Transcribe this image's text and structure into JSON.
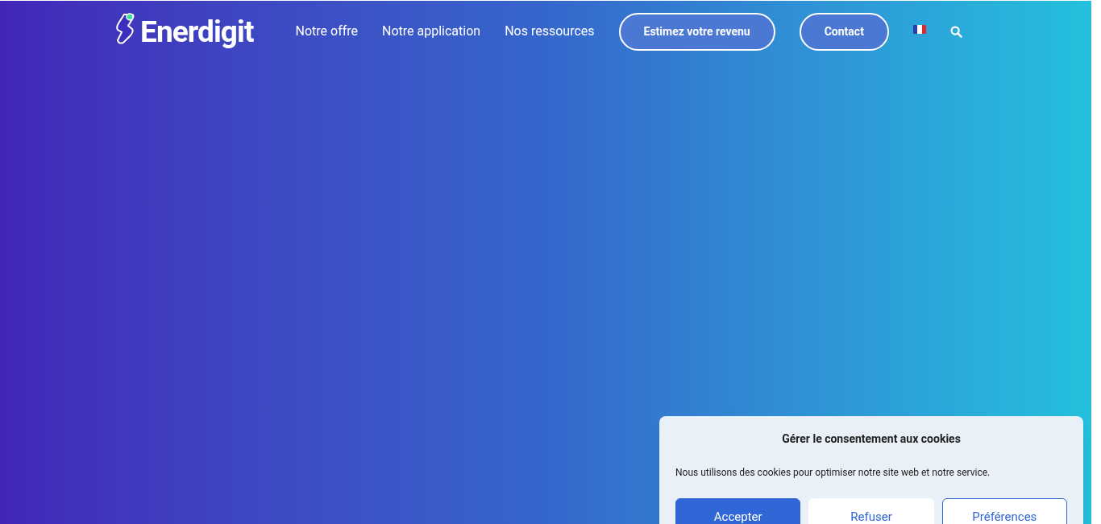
{
  "header": {
    "logo": "Enerdigit",
    "nav": [
      {
        "label": "Notre offre"
      },
      {
        "label": "Notre application"
      },
      {
        "label": "Nos ressources"
      }
    ],
    "cta_buttons": [
      {
        "label": "Estimez votre revenu"
      },
      {
        "label": "Contact"
      }
    ]
  },
  "cookie_banner": {
    "title": "Gérer le consentement aux cookies",
    "message": "Nous utilisons des cookies pour optimiser notre site web et notre service.",
    "buttons": [
      {
        "label": "Accepter",
        "kind": "primary"
      },
      {
        "label": "Refuser",
        "kind": "secondary"
      },
      {
        "label": "Préférences",
        "kind": "outline"
      }
    ]
  }
}
